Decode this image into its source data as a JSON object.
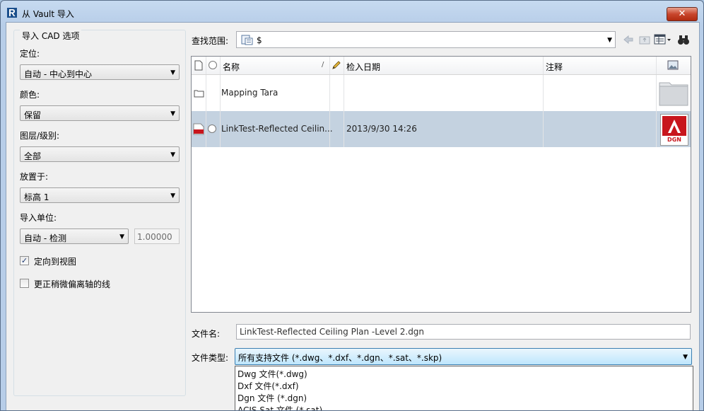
{
  "window": {
    "title": "从 Vault 导入",
    "close_glyph": "✕"
  },
  "left_panel": {
    "group_title": "导入 CAD 选项",
    "positioning": {
      "label": "定位:",
      "value": "自动 - 中心到中心"
    },
    "colors": {
      "label": "颜色:",
      "value": "保留"
    },
    "layers": {
      "label": "图层/级别:",
      "value": "全部"
    },
    "place_at": {
      "label": "放置于:",
      "value": "标高 1"
    },
    "import_units": {
      "label": "导入单位:",
      "value": "自动 - 检测",
      "scale": "1.00000"
    },
    "orient_to_view": {
      "label": "定向到视图",
      "checked": true,
      "check_glyph": "✓"
    },
    "correct_lines": {
      "label": "更正稍微偏离轴的线",
      "checked": false
    }
  },
  "browser": {
    "look_in_label": "查找范围:",
    "look_in_value": "$",
    "toolbar_icons": [
      "back-arrow-icon",
      "up-folder-icon",
      "views-menu-icon",
      "find-icon"
    ],
    "columns": {
      "name": "名称",
      "sort_indicator": "/",
      "checkin_date": "检入日期",
      "comment": "注释"
    },
    "rows": [
      {
        "type": "folder",
        "name": "Mapping Tara",
        "date": "",
        "comment": "",
        "selected": false
      },
      {
        "type": "dgn",
        "name": "LinkTest-Reflected Ceilin...",
        "date": "2013/9/30 14:26",
        "comment": "",
        "selected": true,
        "badge": "DGN"
      }
    ]
  },
  "file_name": {
    "label": "文件名:",
    "value": "LinkTest-Reflected Ceiling Plan -Level 2.dgn"
  },
  "file_type": {
    "label": "文件类型:",
    "value": "所有支持文件 (*.dwg、*.dxf、*.dgn、*.sat、*.skp)",
    "options": [
      "Dwg 文件(*.dwg)",
      "Dxf 文件(*.dxf)",
      "Dgn 文件 (*.dgn)",
      "ACIS Sat 文件 (*.sat)"
    ]
  },
  "colors": {
    "selection": "#c4d2e0",
    "dgn_red": "#c8161d",
    "title_bar": "#c6daf0"
  }
}
